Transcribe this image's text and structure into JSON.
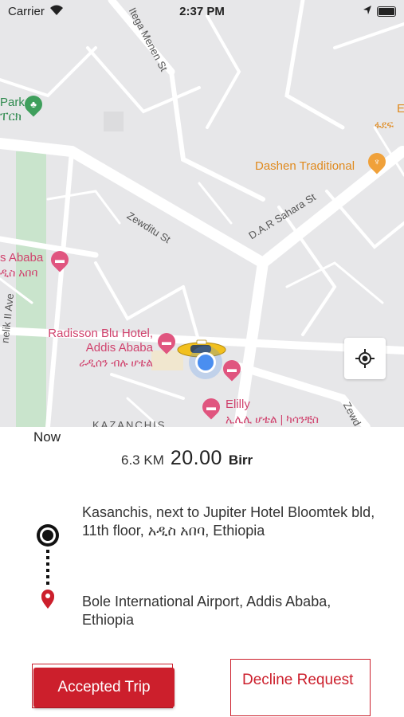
{
  "status_bar": {
    "carrier": "Carrier",
    "time": "2:37 PM"
  },
  "map": {
    "streets": {
      "itega": "Itega Menen St",
      "zewditu": "Zewditu St",
      "dar_sahara": "D.A.R Sahara St",
      "ave": "nelik II Ave",
      "kazanchis": "KAZANCHIS",
      "zewd": "Zewd"
    },
    "pois": {
      "park_1": "Park",
      "park_2": "ፐርክ",
      "dashen": "Dashen Traditional",
      "adfa": "ፋደፍ",
      "adfa_top": "E",
      "ababa_1": "s Ababa",
      "ababa_2": "ዲስ አበባ",
      "radisson_1": "Radisson Blu Hotel,",
      "radisson_2": "Addis Ababa",
      "radisson_3": "ራዲሰን ብሉ ሆቴል",
      "elilly_1": "Elilly",
      "elilly_2": "ኢሊሊ ሆቴል | ካሳንቺስ"
    }
  },
  "trip": {
    "time_label": "Now",
    "distance": "6.3 KM",
    "amount": "20.00",
    "currency": "Birr",
    "pickup": "Kasanchis, next to Jupiter Hotel Bloomtek bld, 11th floor, አዲስ አበባ, Ethiopia",
    "dropoff": "Bole International Airport, Addis Ababa, Ethiopia"
  },
  "actions": {
    "accept": "Accepted Trip",
    "decline": "Decline Request"
  },
  "colors": {
    "accent": "#cc1f2c",
    "map_bg": "#e7e7e9",
    "poi_pink": "#d0426d",
    "poi_orange": "#e08a1e"
  }
}
